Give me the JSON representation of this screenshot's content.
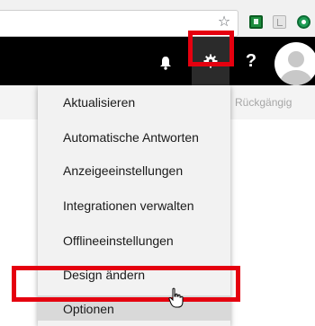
{
  "browser": {
    "icons": [
      "star-icon",
      "extension-green-icon",
      "extension-gray-icon",
      "extension-circle-icon"
    ]
  },
  "header": {
    "help_label": "?",
    "icons": [
      "bell-icon",
      "gear-icon",
      "avatar"
    ]
  },
  "toolbar": {
    "undo_label": "Rückgängig"
  },
  "menu": {
    "items": [
      {
        "label": "Aktualisieren"
      },
      {
        "label": "Automatische Antworten"
      },
      {
        "label": "Anzeigeeinstellungen"
      },
      {
        "label": "Integrationen verwalten"
      },
      {
        "label": "Offlineeinstellungen"
      },
      {
        "label": "Design ändern"
      },
      {
        "label": "Optionen"
      }
    ]
  },
  "colors": {
    "highlight": "#e5000f",
    "header": "#000000",
    "menu_background": "#f2f2f2",
    "hover_row": "#d9d9d9"
  }
}
